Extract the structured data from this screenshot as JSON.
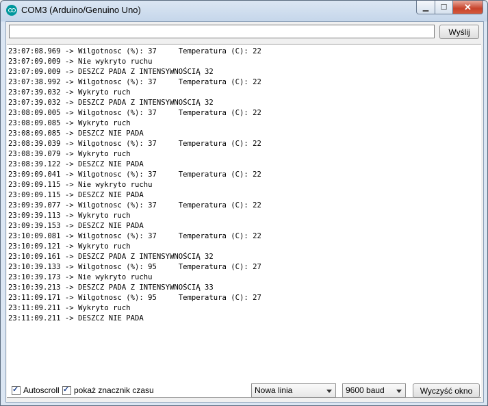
{
  "window": {
    "title": "COM3 (Arduino/Genuino Uno)"
  },
  "send": {
    "input_value": "",
    "button_label": "Wyślij"
  },
  "serial_lines": [
    "23:07:08.969 -> Wilgotnosc (%): 37     Temperatura (C): 22",
    "23:07:09.009 -> Nie wykryto ruchu",
    "23:07:09.009 -> DESZCZ PADA Z INTENSYWNOŚCIĄ 32",
    "23:07:38.992 -> Wilgotnosc (%): 37     Temperatura (C): 22",
    "23:07:39.032 -> Wykryto ruch",
    "23:07:39.032 -> DESZCZ PADA Z INTENSYWNOŚCIĄ 32",
    "23:08:09.005 -> Wilgotnosc (%): 37     Temperatura (C): 22",
    "23:08:09.085 -> Wykryto ruch",
    "23:08:09.085 -> DESZCZ NIE PADA",
    "23:08:39.039 -> Wilgotnosc (%): 37     Temperatura (C): 22",
    "23:08:39.079 -> Wykryto ruch",
    "23:08:39.122 -> DESZCZ NIE PADA",
    "23:09:09.041 -> Wilgotnosc (%): 37     Temperatura (C): 22",
    "23:09:09.115 -> Nie wykryto ruchu",
    "23:09:09.115 -> DESZCZ NIE PADA",
    "23:09:39.077 -> Wilgotnosc (%): 37     Temperatura (C): 22",
    "23:09:39.113 -> Wykryto ruch",
    "23:09:39.153 -> DESZCZ NIE PADA",
    "23:10:09.081 -> Wilgotnosc (%): 37     Temperatura (C): 22",
    "23:10:09.121 -> Wykryto ruch",
    "23:10:09.161 -> DESZCZ PADA Z INTENSYWNOŚCIĄ 32",
    "23:10:39.133 -> Wilgotnosc (%): 95     Temperatura (C): 27",
    "23:10:39.173 -> Nie wykryto ruchu",
    "23:10:39.213 -> DESZCZ PADA Z INTENSYWNOŚCIĄ 33",
    "23:11:09.171 -> Wilgotnosc (%): 95     Temperatura (C): 27",
    "23:11:09.211 -> Wykryto ruch",
    "23:11:09.211 -> DESZCZ NIE PADA"
  ],
  "footer": {
    "autoscroll_label": "Autoscroll",
    "autoscroll_checked": true,
    "timestamp_label": "pokaż znacznik czasu",
    "timestamp_checked": true,
    "line_ending": "Nowa linia",
    "baud": "9600 baud",
    "clear_label": "Wyczyść okno"
  },
  "icons": {
    "app": "arduino-icon",
    "minimize": "minimize-icon",
    "maximize": "maximize-icon",
    "close": "close-icon",
    "dropdown": "chevron-down-icon",
    "check": "checkmark-icon"
  },
  "colors": {
    "arduino_teal": "#00979c",
    "close_red": "#c7432c"
  }
}
